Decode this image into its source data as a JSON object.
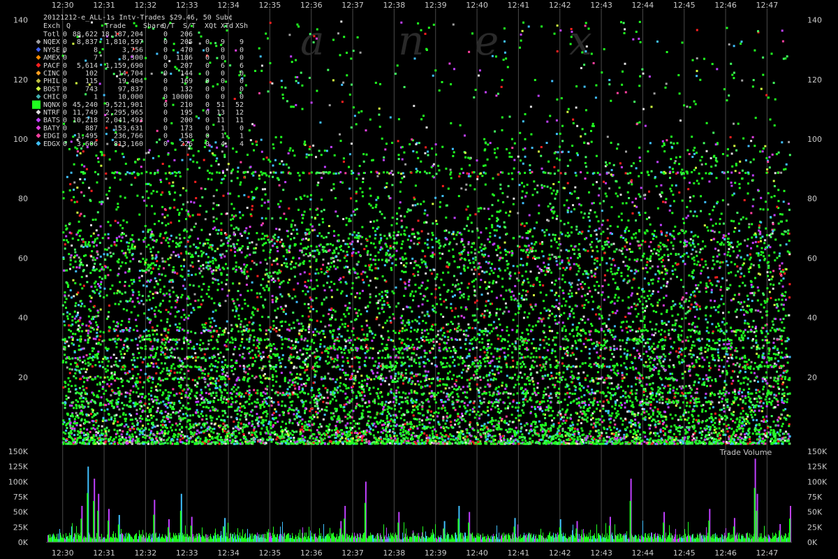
{
  "chart_data": [
    {
      "type": "scatter",
      "title": "20121212-e_ALL-1s Intv-Trades $29.46, 50 Sub¢",
      "xlabel": "",
      "ylabel": "",
      "x_ticks": [
        "12:30",
        "12:31",
        "12:32",
        "12:33",
        "12:34",
        "12:35",
        "12:36",
        "12:37",
        "12:38",
        "12:39",
        "12:40",
        "12:41",
        "12:42",
        "12:43",
        "12:44",
        "12:45",
        "12:46",
        "12:47"
      ],
      "x_range_minutes": [
        -0.4,
        17.6
      ],
      "ylim": [
        -3,
        142
      ],
      "y_ticks": [
        20,
        40,
        60,
        80,
        100,
        120,
        140
      ],
      "grid": "vertical",
      "watermark": [
        "a",
        "n",
        "e",
        "x"
      ],
      "legend_header": [
        "Exch",
        "Q",
        "Trade",
        "Share",
        "Q/T",
        "S/T",
        "XQt",
        "XTd",
        "XSh"
      ],
      "legend": [
        {
          "exch": "Totl",
          "q": "0",
          "trade": "88,622",
          "share": "18,187,204",
          "qt": "0",
          "st": "206",
          "xqt": "",
          "xtd": "",
          "xsh": "",
          "color": ""
        },
        {
          "exch": "NQEX",
          "q": "0",
          "trade": "8,837",
          "share": "1,810,597",
          "qt": "0",
          "st": "205",
          "xqt": "0",
          "xtd": "9",
          "xsh": "9",
          "color": "#a0a0a0"
        },
        {
          "exch": "NYSE",
          "q": "0",
          "trade": "8",
          "share": "3,756",
          "qt": "0",
          "st": "470",
          "xqt": "0",
          "xtd": "0",
          "xsh": "0",
          "color": "#4060ff"
        },
        {
          "exch": "AMEX",
          "q": "0",
          "trade": "7",
          "share": "8,300",
          "qt": "0",
          "st": "1186",
          "xqt": "0",
          "xtd": "0",
          "xsh": "0",
          "color": "#ff8c00"
        },
        {
          "exch": "PACF",
          "q": "0",
          "trade": "5,614",
          "share": "1,159,690",
          "qt": "0",
          "st": "207",
          "xqt": "0",
          "xtd": "6",
          "xsh": "6",
          "color": "#ff2020"
        },
        {
          "exch": "CINC",
          "q": "0",
          "trade": "102",
          "share": "14,704",
          "qt": "0",
          "st": "144",
          "xqt": "0",
          "xtd": "0",
          "xsh": "0",
          "color": "#ffa020"
        },
        {
          "exch": "PHIL",
          "q": "0",
          "trade": "115",
          "share": "19,404",
          "qt": "0",
          "st": "169",
          "xqt": "0",
          "xtd": "0",
          "xsh": "0",
          "color": "#c0c040"
        },
        {
          "exch": "BOST",
          "q": "0",
          "trade": "743",
          "share": "97,837",
          "qt": "0",
          "st": "132",
          "xqt": "0",
          "xtd": "0",
          "xsh": "0",
          "color": "#d0ff40"
        },
        {
          "exch": "CHIC",
          "q": "0",
          "trade": "1",
          "share": "10,000",
          "qt": "0",
          "st": "10000",
          "xqt": "0",
          "xtd": "0",
          "xsh": "0",
          "color": "#40b0b0"
        },
        {
          "exch": "NQNX",
          "q": "0",
          "trade": "45,240",
          "share": "9,521,901",
          "qt": "0",
          "st": "210",
          "xqt": "0",
          "xtd": "51",
          "xsh": "52",
          "color": "#20ff20"
        },
        {
          "exch": "NTRF",
          "q": "0",
          "trade": "11,749",
          "share": "2,295,965",
          "qt": "0",
          "st": "195",
          "xqt": "0",
          "xtd": "13",
          "xsh": "12",
          "color": "#e0e0e0"
        },
        {
          "exch": "BATS",
          "q": "0",
          "trade": "10,218",
          "share": "2,041,493",
          "qt": "0",
          "st": "200",
          "xqt": "0",
          "xtd": "11",
          "xsh": "11",
          "color": "#c040ff"
        },
        {
          "exch": "BATY",
          "q": "0",
          "trade": "887",
          "share": "153,631",
          "qt": "0",
          "st": "173",
          "xqt": "0",
          "xtd": "1",
          "xsh": "0",
          "color": "#e040e0"
        },
        {
          "exch": "EDGI",
          "q": "0",
          "trade": "1,495",
          "share": "236,766",
          "qt": "0",
          "st": "158",
          "xqt": "0",
          "xtd": "1",
          "xsh": "1",
          "color": "#ff40a0"
        },
        {
          "exch": "EDGX",
          "q": "0",
          "trade": "3,606",
          "share": "813,160",
          "qt": "0",
          "st": "226",
          "xqt": "0",
          "xtd": "4",
          "xsh": "4",
          "color": "#40c0ff"
        }
      ],
      "highlight": "NQNX"
    },
    {
      "type": "area",
      "title": "Trade Volume",
      "ylim": [
        0,
        150000
      ],
      "y_ticks": [
        {
          "v": 0,
          "label": "0K"
        },
        {
          "v": 25000,
          "label": "25K"
        },
        {
          "v": 50000,
          "label": "50K"
        },
        {
          "v": 75000,
          "label": "75K"
        },
        {
          "v": 100000,
          "label": "100K"
        },
        {
          "v": 125000,
          "label": "125K"
        },
        {
          "v": 150000,
          "label": "150K"
        }
      ],
      "spikes": [
        {
          "t": 0.6,
          "v": 125000
        },
        {
          "t": 0.75,
          "v": 105000
        },
        {
          "t": 0.45,
          "v": 60000
        },
        {
          "t": 0.85,
          "v": 80000
        },
        {
          "t": 1.1,
          "v": 55000
        },
        {
          "t": 1.35,
          "v": 45000
        },
        {
          "t": 2.2,
          "v": 70000
        },
        {
          "t": 2.55,
          "v": 38000
        },
        {
          "t": 2.85,
          "v": 80000
        },
        {
          "t": 3.1,
          "v": 42000
        },
        {
          "t": 3.9,
          "v": 40000
        },
        {
          "t": 6.8,
          "v": 60000
        },
        {
          "t": 6.7,
          "v": 35000
        },
        {
          "t": 7.3,
          "v": 100000
        },
        {
          "t": 8.1,
          "v": 50000
        },
        {
          "t": 9.2,
          "v": 35000
        },
        {
          "t": 9.55,
          "v": 60000
        },
        {
          "t": 9.8,
          "v": 50000
        },
        {
          "t": 10.9,
          "v": 40000
        },
        {
          "t": 12.0,
          "v": 38000
        },
        {
          "t": 12.4,
          "v": 35000
        },
        {
          "t": 13.2,
          "v": 42000
        },
        {
          "t": 13.7,
          "v": 105000
        },
        {
          "t": 14.5,
          "v": 50000
        },
        {
          "t": 15.6,
          "v": 55000
        },
        {
          "t": 16.2,
          "v": 40000
        },
        {
          "t": 16.7,
          "v": 138000
        },
        {
          "t": 16.75,
          "v": 80000
        },
        {
          "t": 17.3,
          "v": 30000
        },
        {
          "t": 17.55,
          "v": 60000
        }
      ]
    }
  ]
}
